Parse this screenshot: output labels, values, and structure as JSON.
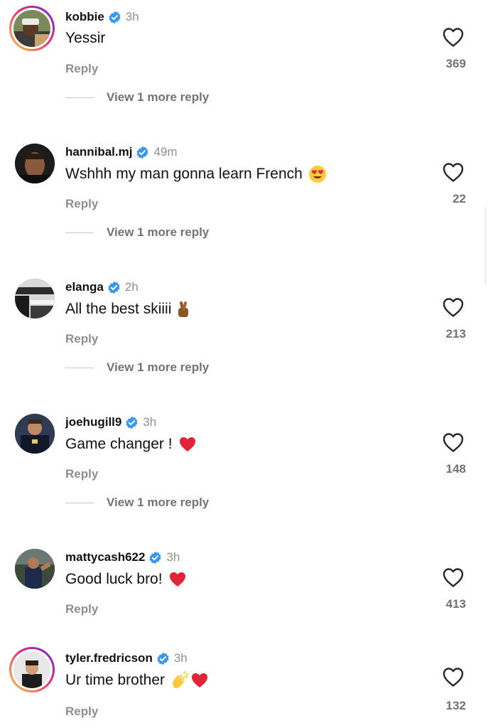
{
  "colors": {
    "verified": "#3897f0",
    "muted": "#8e8e8e",
    "heart_outline": "#262626"
  },
  "comments": [
    {
      "username": "kobbie",
      "time": "3h",
      "text": "Yessir",
      "emoji": [],
      "likes": "369",
      "reply": "Reply",
      "more": "View 1 more reply",
      "avatar_icon": "story-ring-avatar"
    },
    {
      "username": "hannibal.mj",
      "time": "49m",
      "text": "Wshhh my man gonna learn French",
      "emoji": [
        "heart-eyes-emoji"
      ],
      "likes": "22",
      "reply": "Reply",
      "more": "View 1 more reply",
      "avatar_icon": "avatar"
    },
    {
      "username": "elanga",
      "time": "2h",
      "text": "All the best skiiii",
      "emoji": [
        "crossed-fingers-emoji"
      ],
      "likes": "213",
      "reply": "Reply",
      "more": "View 1 more reply",
      "avatar_icon": "avatar"
    },
    {
      "username": "joehugill9",
      "time": "3h",
      "text": "Game changer !",
      "emoji": [
        "red-heart-emoji"
      ],
      "likes": "148",
      "reply": "Reply",
      "more": "View 1 more reply",
      "avatar_icon": "avatar"
    },
    {
      "username": "mattycash622",
      "time": "3h",
      "text": "Good luck bro!",
      "emoji": [
        "red-heart-emoji"
      ],
      "likes": "413",
      "reply": "Reply",
      "more": "",
      "avatar_icon": "avatar"
    },
    {
      "username": "tyler.fredricson",
      "time": "3h",
      "text": "Ur time brother",
      "emoji": [
        "clapping-hands-emoji",
        "red-heart-emoji"
      ],
      "likes": "132",
      "reply": "Reply",
      "more": "",
      "avatar_icon": "story-ring-avatar"
    }
  ]
}
